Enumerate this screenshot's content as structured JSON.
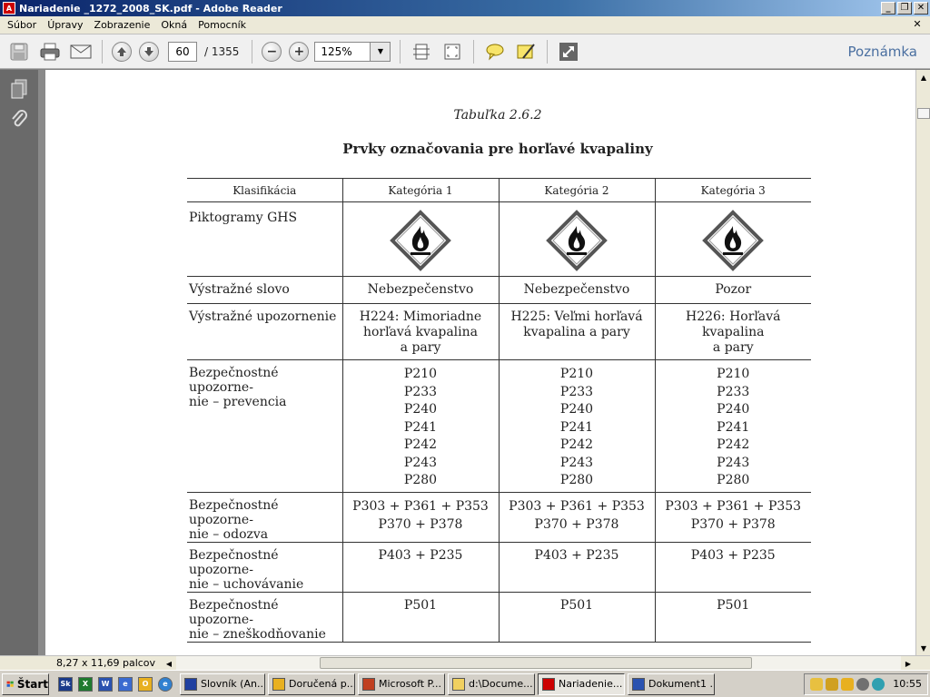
{
  "window": {
    "title": "Nariadenie _1272_2008_SK.pdf - Adobe Reader",
    "app_icon": "adobe-reader-icon"
  },
  "menu": {
    "items": [
      "Súbor",
      "Úpravy",
      "Zobrazenie",
      "Okná",
      "Pomocník"
    ]
  },
  "toolbar": {
    "page_current": "60",
    "page_total": "/ 1355",
    "zoom": "125%",
    "note_label": "Poznámka"
  },
  "document": {
    "table_number": "Tabuľka 2.6.2",
    "table_title": "Prvky označovania pre horľavé kvapaliny",
    "headers": [
      "Klasifikácia",
      "Kategória 1",
      "Kategória 2",
      "Kategória 3"
    ],
    "row_labels": {
      "pictograms": "Piktogramy GHS",
      "signal_word": "Výstražné slovo",
      "hazard_statement": "Výstražné upozornenie",
      "prevention_1": "Bezpečnostné upozorne-",
      "prevention_2": "nie – prevencia",
      "response_1": "Bezpečnostné upozorne-",
      "response_2": "nie – odozva",
      "storage_1": "Bezpečnostné upozorne-",
      "storage_2": "nie – uchovávanie",
      "disposal_1": "Bezpečnostné upozorne-",
      "disposal_2": "nie – zneškodňovanie"
    },
    "categories": [
      {
        "signal_word": "Nebezpečenstvo",
        "hazard_lines": [
          "H224: Mimoriadne",
          "horľavá kvapalina",
          "a pary"
        ],
        "prevention": [
          "P210",
          "P233",
          "P240",
          "P241",
          "P242",
          "P243",
          "P280"
        ],
        "response_lines": [
          "P303 + P361 + P353",
          "P370 + P378"
        ],
        "storage": "P403 + P235",
        "disposal": "P501"
      },
      {
        "signal_word": "Nebezpečenstvo",
        "hazard_lines": [
          "H225: Veľmi horľavá",
          "kvapalina a pary"
        ],
        "prevention": [
          "P210",
          "P233",
          "P240",
          "P241",
          "P242",
          "P243",
          "P280"
        ],
        "response_lines": [
          "P303 + P361 + P353",
          "P370 + P378"
        ],
        "storage": "P403 + P235",
        "disposal": "P501"
      },
      {
        "signal_word": "Pozor",
        "hazard_lines": [
          "H226: Horľavá kvapalina",
          "a pary"
        ],
        "prevention": [
          "P210",
          "P233",
          "P240",
          "P241",
          "P242",
          "P243",
          "P280"
        ],
        "response_lines": [
          "P303 + P361 + P353",
          "P370 + P378"
        ],
        "storage": "P403 + P235",
        "disposal": "P501"
      }
    ]
  },
  "status": {
    "page_size": "8,27 x 11,69 palcov"
  },
  "taskbar": {
    "start_label": "Štart",
    "tasks": [
      {
        "label": "Slovník (An...",
        "icon": "dictionary-icon",
        "active": false
      },
      {
        "label": "Doručená p...",
        "icon": "outlook-icon",
        "active": false
      },
      {
        "label": "Microsoft P...",
        "icon": "powerpoint-icon",
        "active": false
      },
      {
        "label": "d:\\Docume...",
        "icon": "folder-icon",
        "active": false
      },
      {
        "label": "Nariadenie...",
        "icon": "pdf-icon",
        "active": true
      },
      {
        "label": "Dokument1 ...",
        "icon": "word-icon",
        "active": false
      }
    ],
    "clock": "10:55"
  },
  "colors": {
    "title_gradient_start": "#0a246a",
    "pictogram_red": "#cc0000",
    "note_blue": "#4a6fa0"
  }
}
